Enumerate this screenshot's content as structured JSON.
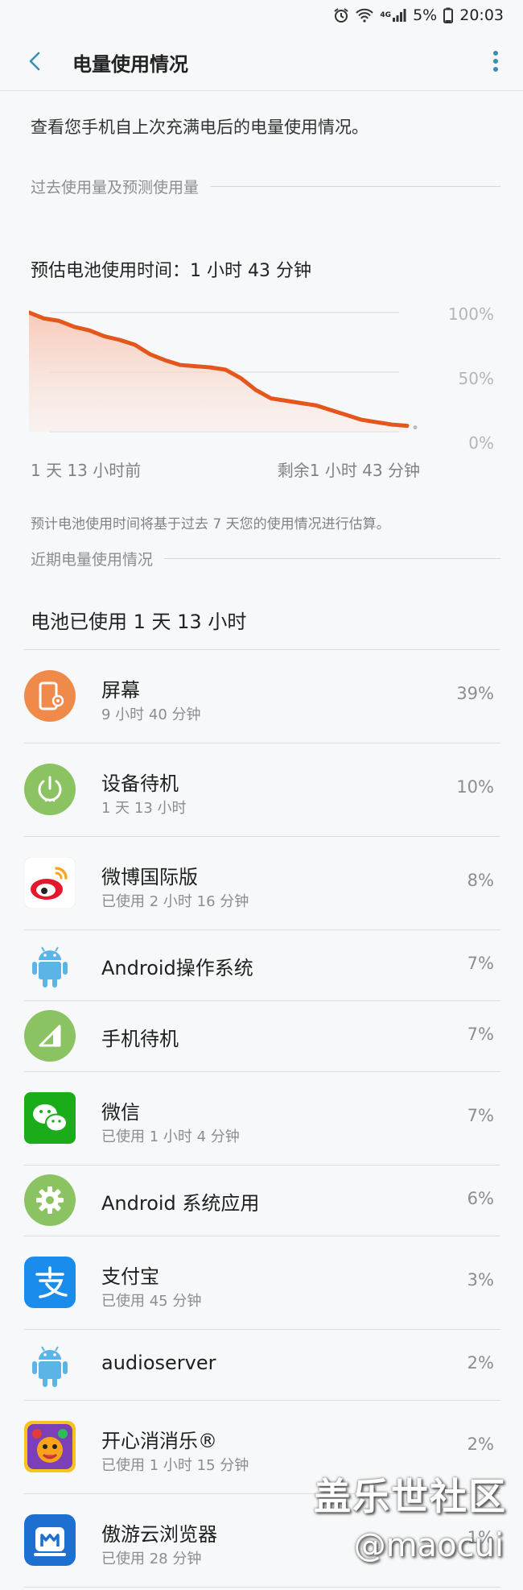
{
  "status_bar": {
    "battery": "5%",
    "time": "20:03",
    "network": "4G"
  },
  "app_bar": {
    "title": "电量使用情况"
  },
  "description": "查看您手机自上次充满电后的电量使用情况。",
  "section_past": "过去使用量及预测使用量",
  "estimate": "预估电池使用时间：1 小时 43 分钟",
  "chart_data": {
    "type": "area",
    "x_start_label": "1 天 13 小时前",
    "x_end_label": "剩余1 小时 43 分钟",
    "y_ticks": [
      "100%",
      "50%",
      "0%"
    ],
    "ylim": [
      0,
      100
    ],
    "x": [
      0,
      4,
      8,
      12,
      16,
      20,
      24,
      28,
      32,
      36,
      40,
      44,
      48,
      52,
      56,
      60,
      64,
      68,
      72,
      76,
      80,
      84,
      88,
      92,
      96,
      100
    ],
    "values": [
      100,
      95,
      93,
      88,
      85,
      80,
      77,
      73,
      65,
      60,
      56,
      55,
      54,
      52,
      45,
      35,
      28,
      26,
      24,
      22,
      18,
      14,
      10,
      8,
      6,
      5
    ],
    "grid": true,
    "color": "#e4571c"
  },
  "note": "预计电池使用时间将基于过去 7 天您的使用情况进行估算。",
  "section_recent": "近期电量使用情况",
  "used_total": "电池已使用 1 天 13 小时",
  "apps": [
    {
      "name": "屏幕",
      "sub": "9 小时 40 分钟",
      "pct": "39%",
      "icon": "screen-icon"
    },
    {
      "name": "设备待机",
      "sub": "1 天 13 小时",
      "pct": "10%",
      "icon": "power-icon"
    },
    {
      "name": "微博国际版",
      "sub": "已使用 2 小时 16 分钟",
      "pct": "8%",
      "icon": "weibo-icon"
    },
    {
      "name": "Android操作系统",
      "sub": "",
      "pct": "7%",
      "icon": "android-icon"
    },
    {
      "name": "手机待机",
      "sub": "",
      "pct": "7%",
      "icon": "signal-icon"
    },
    {
      "name": "微信",
      "sub": "已使用 1 小时 4 分钟",
      "pct": "7%",
      "icon": "wechat-icon"
    },
    {
      "name": "Android 系统应用",
      "sub": "",
      "pct": "6%",
      "icon": "gear-icon"
    },
    {
      "name": "支付宝",
      "sub": "已使用 45 分钟",
      "pct": "3%",
      "icon": "alipay-icon"
    },
    {
      "name": "audioserver",
      "sub": "",
      "pct": "2%",
      "icon": "android-icon"
    },
    {
      "name": "开心消消乐®",
      "sub": "已使用 1 小时 15 分钟",
      "pct": "2%",
      "icon": "game-icon"
    },
    {
      "name": "傲游云浏览器",
      "sub": "已使用 28 分钟",
      "pct": "1%",
      "icon": "maxthon-icon"
    }
  ],
  "watermark": {
    "line1": "盖乐世社区",
    "line2": "@maocui"
  }
}
